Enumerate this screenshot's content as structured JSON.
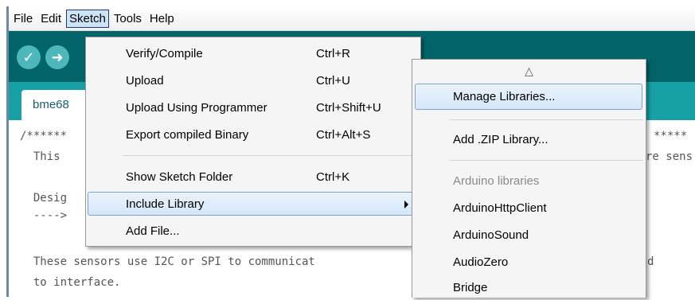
{
  "menubar": {
    "items": [
      {
        "label": "File"
      },
      {
        "label": "Edit"
      },
      {
        "label": "Sketch"
      },
      {
        "label": "Tools"
      },
      {
        "label": "Help"
      }
    ]
  },
  "toolbar": {
    "verify_icon": "✓",
    "upload_icon": "➜"
  },
  "tabs": [
    {
      "label": "bme68"
    }
  ],
  "editor": {
    "lines": [
      "/******",
      "  This",
      "",
      "  Desig",
      "  ---->",
      "",
      "  These sensors use I2C or SPI to communicat",
      "  to interface."
    ],
    "right_fragments": [
      "*****",
      "re sens",
      "d"
    ]
  },
  "sketch_menu": {
    "items": [
      {
        "label": "Verify/Compile",
        "shortcut": "Ctrl+R"
      },
      {
        "label": "Upload",
        "shortcut": "Ctrl+U"
      },
      {
        "label": "Upload Using Programmer",
        "shortcut": "Ctrl+Shift+U"
      },
      {
        "label": "Export compiled Binary",
        "shortcut": "Ctrl+Alt+S"
      },
      {
        "label": "Show Sketch Folder",
        "shortcut": "Ctrl+K"
      },
      {
        "label": "Include Library",
        "shortcut": ""
      },
      {
        "label": "Add File...",
        "shortcut": ""
      }
    ]
  },
  "library_menu": {
    "scroll_up_glyph": "△",
    "manage": "Manage Libraries...",
    "add_zip": "Add .ZIP Library...",
    "section_header": "Arduino libraries",
    "libraries": [
      "ArduinoHttpClient",
      "ArduinoSound",
      "AudioZero",
      "Bridge"
    ]
  },
  "colors": {
    "toolbar": "#006468",
    "tabstrip": "#17a1a5",
    "button": "#4db7bb",
    "highlight_border": "#7da2ce"
  }
}
